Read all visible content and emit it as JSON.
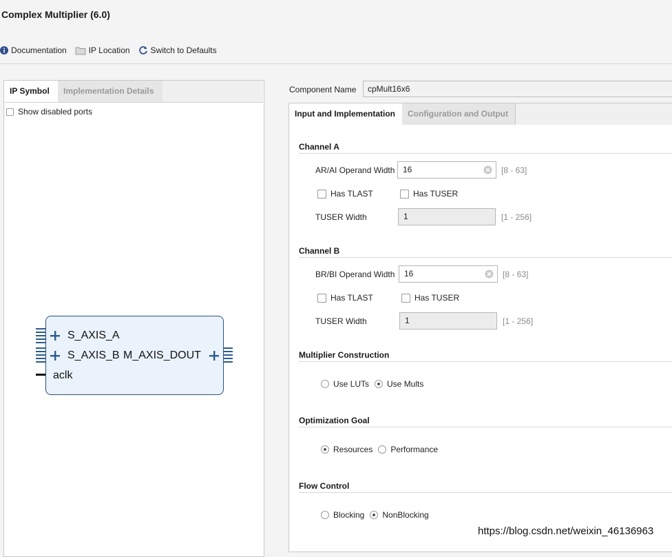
{
  "window": {
    "title": "Complex Multiplier (6.0)"
  },
  "toolbar": {
    "documentation": "Documentation",
    "ip_location": "IP Location",
    "switch_defaults": "Switch to Defaults"
  },
  "left_tabs": [
    {
      "label": "IP Symbol",
      "active": true
    },
    {
      "label": "Implementation Details",
      "active": false
    }
  ],
  "show_disabled_ports": {
    "label": "Show disabled ports",
    "checked": false
  },
  "ip_symbol": {
    "ports_left": [
      "S_AXIS_A",
      "S_AXIS_B",
      "aclk"
    ],
    "ports_right": [
      "M_AXIS_DOUT"
    ]
  },
  "component_name": {
    "label": "Component Name",
    "value": "cpMult16x6"
  },
  "right_tabs": [
    {
      "label": "Input and Implementation",
      "active": true
    },
    {
      "label": "Configuration and Output",
      "active": false
    }
  ],
  "channel_a": {
    "title": "Channel A",
    "operand_label": "AR/AI Operand Width",
    "operand_value": "16",
    "operand_range": "[8 - 63]",
    "tlast_label": "Has TLAST",
    "tuser_label": "Has TUSER",
    "tuser_width_label": "TUSER Width",
    "tuser_width_value": "1",
    "tuser_width_range": "[1 - 256]"
  },
  "channel_b": {
    "title": "Channel B",
    "operand_label": "BR/BI Operand Width",
    "operand_value": "16",
    "operand_range": "[8 - 63]",
    "tlast_label": "Has TLAST",
    "tuser_label": "Has TUSER",
    "tuser_width_label": "TUSER Width",
    "tuser_width_value": "1",
    "tuser_width_range": "[1 - 256]"
  },
  "multiplier_construction": {
    "title": "Multiplier Construction",
    "options": [
      {
        "label": "Use LUTs",
        "selected": false
      },
      {
        "label": "Use Mults",
        "selected": true
      }
    ]
  },
  "optimization_goal": {
    "title": "Optimization Goal",
    "options": [
      {
        "label": "Resources",
        "selected": true
      },
      {
        "label": "Performance",
        "selected": false
      }
    ]
  },
  "flow_control": {
    "title": "Flow Control",
    "options": [
      {
        "label": "Blocking",
        "selected": false
      },
      {
        "label": "NonBlocking",
        "selected": true
      }
    ]
  },
  "watermark": "https://blog.csdn.net/weixin_46136963",
  "colors": {
    "block_fill": "#eaf2fb",
    "block_border": "#2c4f7a",
    "port_blue": "#2a5b8e"
  }
}
